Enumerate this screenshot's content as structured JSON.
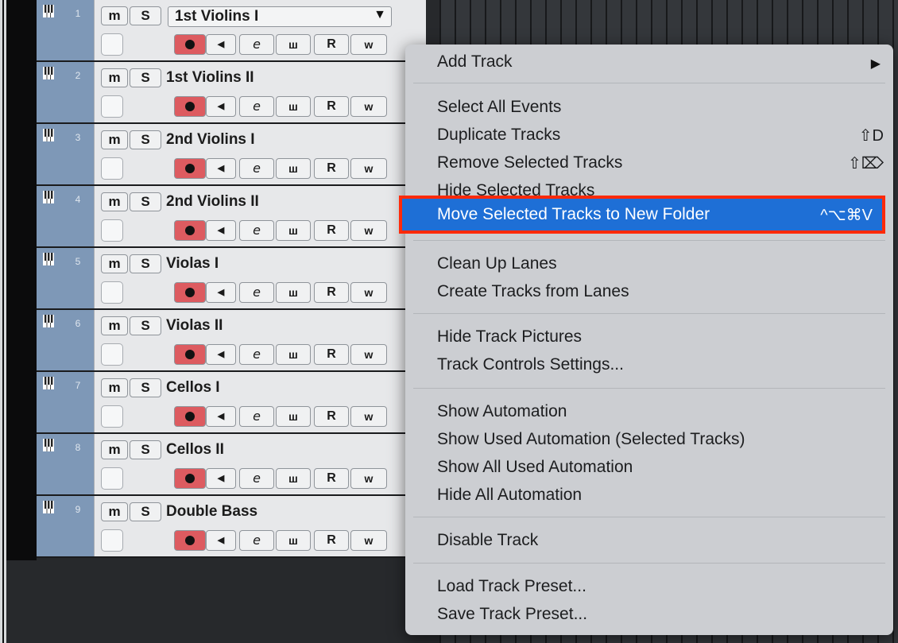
{
  "tracks": [
    {
      "number": "1",
      "name": "1st Violins I",
      "selector": true
    },
    {
      "number": "2",
      "name": "1st Violins II"
    },
    {
      "number": "3",
      "name": "2nd Violins I"
    },
    {
      "number": "4",
      "name": "2nd Violins II"
    },
    {
      "number": "5",
      "name": "Violas I"
    },
    {
      "number": "6",
      "name": "Violas II"
    },
    {
      "number": "7",
      "name": "Cellos I"
    },
    {
      "number": "8",
      "name": "Cellos II"
    },
    {
      "number": "9",
      "name": "Double Bass"
    }
  ],
  "track_buttons": {
    "mute": "m",
    "solo": "S",
    "edit": "e",
    "read": "R",
    "write": "w",
    "keyboard": "ш"
  },
  "icons": {
    "track_type": "piano-keys-icon",
    "record": "record-icon",
    "monitor": "speaker-icon",
    "dropdown": "chevron-down-icon",
    "submenu": "submenu-arrow-icon"
  },
  "colors": {
    "track_strip": "#7e98b7",
    "record_active": "#dd5b60",
    "menu_bg": "#ccced2",
    "menu_highlight": "#1e6fd6",
    "highlight_border": "#ff2a0a"
  },
  "menu": {
    "add_track": "Add Track",
    "add_track_arrow": "▶",
    "select_all_events": "Select All Events",
    "duplicate_tracks": "Duplicate Tracks",
    "duplicate_tracks_shortcut": "⇧D",
    "remove_selected_tracks": "Remove Selected Tracks",
    "remove_selected_tracks_shortcut": "⇧⌦",
    "hide_selected_tracks": "Hide Selected Tracks",
    "move_to_folder": "Move Selected Tracks to New Folder",
    "move_to_folder_shortcut": "^⌥⌘V",
    "clean_up_lanes": "Clean Up Lanes",
    "create_tracks_from_lanes": "Create Tracks from Lanes",
    "hide_track_pictures": "Hide Track Pictures",
    "track_controls_settings": "Track Controls Settings...",
    "show_automation": "Show Automation",
    "show_used_automation_selected": "Show Used Automation (Selected Tracks)",
    "show_all_used_automation": "Show All Used Automation",
    "hide_all_automation": "Hide All Automation",
    "disable_track": "Disable Track",
    "load_track_preset": "Load Track Preset...",
    "save_track_preset": "Save Track Preset..."
  }
}
